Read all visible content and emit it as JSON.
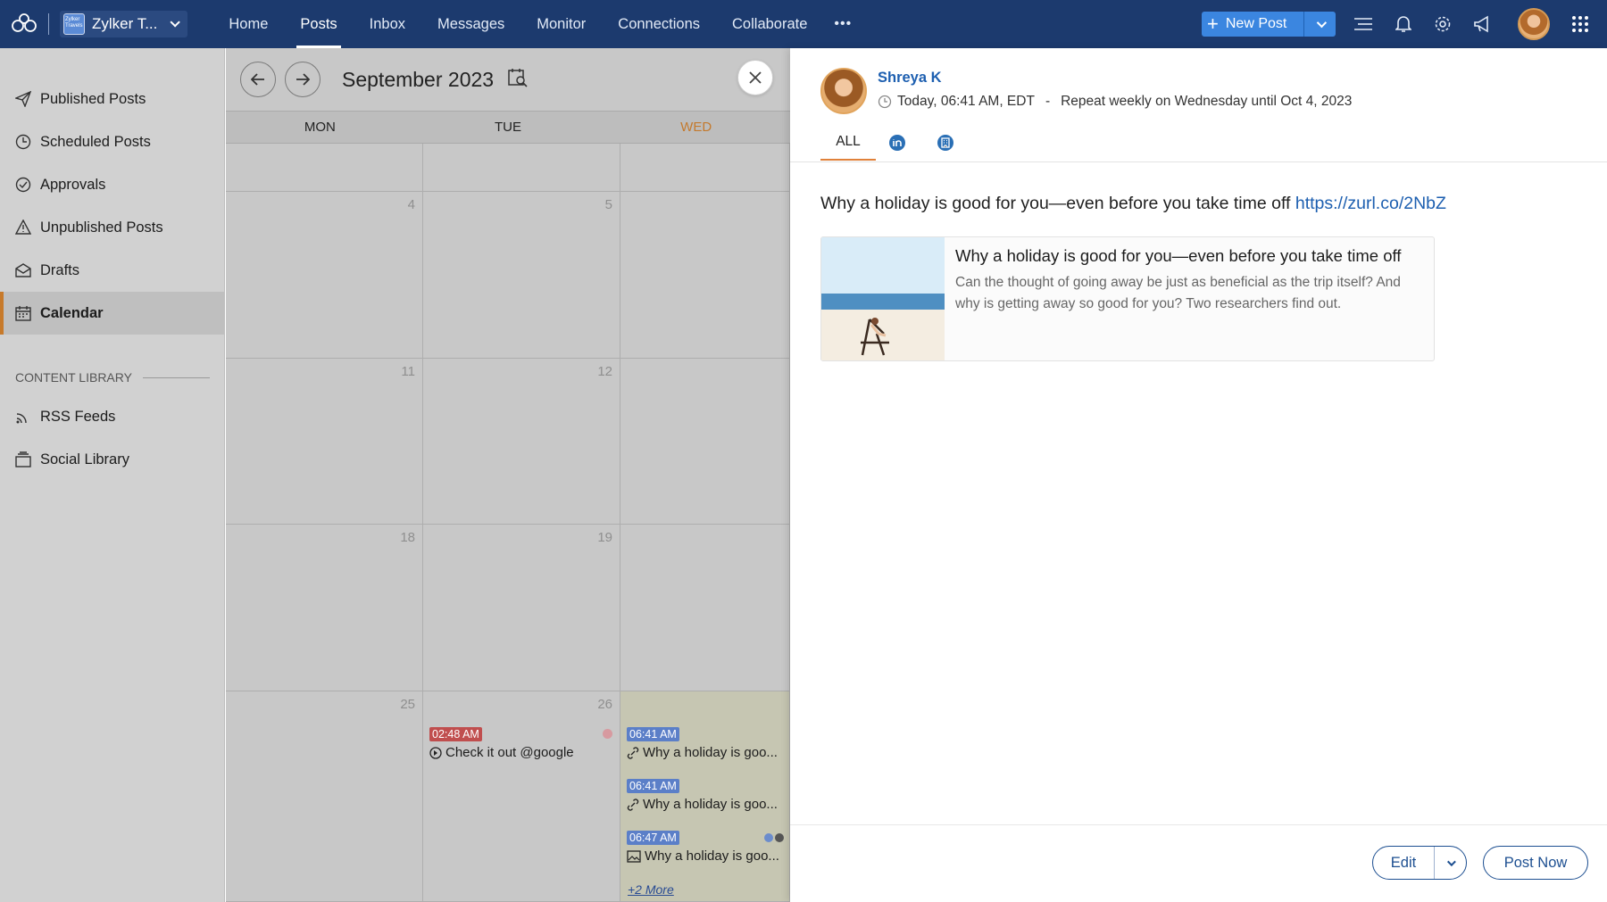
{
  "topbar": {
    "brand": "Zylker T...",
    "brand_logo_text": "Zylker Travels",
    "nav": [
      "Home",
      "Posts",
      "Inbox",
      "Messages",
      "Monitor",
      "Connections",
      "Collaborate"
    ],
    "active_nav": "Posts",
    "more": "•••",
    "new_post": "New Post",
    "colors": {
      "bg": "#1c3a6e",
      "button": "#3b86e0"
    }
  },
  "sidebar": {
    "items": [
      {
        "label": "Published Posts",
        "icon": "paper-plane-icon"
      },
      {
        "label": "Scheduled Posts",
        "icon": "clock-icon"
      },
      {
        "label": "Approvals",
        "icon": "check-circle-icon"
      },
      {
        "label": "Unpublished Posts",
        "icon": "warning-icon"
      },
      {
        "label": "Drafts",
        "icon": "drafts-icon"
      },
      {
        "label": "Calendar",
        "icon": "calendar-icon",
        "active": true
      }
    ],
    "section_title": "CONTENT LIBRARY",
    "library": [
      {
        "label": "RSS Feeds",
        "icon": "rss-icon"
      },
      {
        "label": "Social Library",
        "icon": "library-icon"
      }
    ]
  },
  "calendar": {
    "title": "September 2023",
    "days": [
      "MON",
      "TUE",
      "WED"
    ],
    "weeks": [
      [
        "",
        "",
        ""
      ],
      [
        "4",
        "5",
        ""
      ],
      [
        "11",
        "12",
        ""
      ],
      [
        "18",
        "19",
        ""
      ],
      [
        "25",
        "26",
        ""
      ]
    ],
    "events_tue": [
      {
        "time": "02:48 AM",
        "text": "Check it out @google"
      }
    ],
    "events_wed": [
      {
        "time": "06:41 AM",
        "text": "Why a holiday is goo..."
      },
      {
        "time": "06:41 AM",
        "text": "Why a holiday is goo..."
      },
      {
        "time": "06:47 AM",
        "text": "Why a holiday is goo..."
      }
    ],
    "more_link": "+2 More"
  },
  "post": {
    "author": "Shreya K",
    "time": "Today, 06:41 AM, EDT",
    "separator": "-",
    "repeat": "Repeat weekly on Wednesday until Oct 4, 2023",
    "tabs": [
      "ALL"
    ],
    "text": "Why a holiday is good for you—even before you take time off ",
    "link": "https://zurl.co/2NbZ",
    "card_title": "Why a holiday is good for you—even before you take time off",
    "card_desc": "Can the thought of going away be just as beneficial as the trip itself? And why is getting away so good for you? Two researchers find out.",
    "edit": "Edit",
    "post_now": "Post Now"
  }
}
